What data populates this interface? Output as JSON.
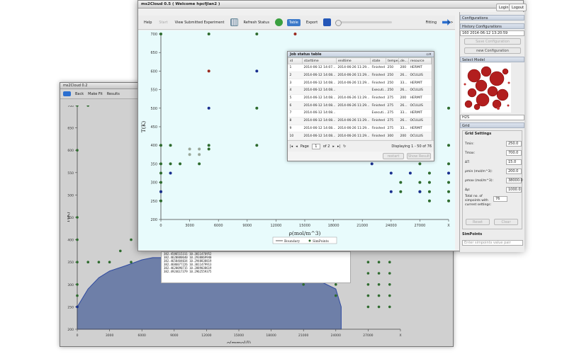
{
  "front": {
    "title": "ms2Cloud 0.5 ( Welcome hpcfjlan2 )",
    "login": "Login",
    "logout": "Logout",
    "toolbar": {
      "help": "Help",
      "start": "Start",
      "view_submitted": "View Submitted Experiment",
      "refresh": "Refresh Status",
      "table": "Table",
      "export": "Export",
      "fitting": "Fitting"
    },
    "chevrons": ">>"
  },
  "right_panel": {
    "configurations": "Configurations",
    "history_configurations": "History Configurations",
    "history_value": "160 2014-06-12 13:20:59",
    "save_configuration": "Save Configuration",
    "new_configuration": "new Configuration",
    "select_model": "Select Model",
    "model_value": "H2S",
    "grid": "Grid",
    "grid_settings": "Grid Settings",
    "fields": [
      {
        "label": "Tmin:",
        "value": "250.0"
      },
      {
        "label": "Tmax:",
        "value": "700.0"
      },
      {
        "label": "ΔT:",
        "value": "15.0"
      },
      {
        "label": "ρmin (mol/m^3):",
        "value": "200.0"
      },
      {
        "label": "ρmax (mol/m^3):",
        "value": "38000.0"
      },
      {
        "label": "Δρ:",
        "value": "1000.0"
      }
    ],
    "total_label": "Total no. of simpoints with current settings:",
    "total_value": "76",
    "reset": "Reset",
    "clear": "Clear",
    "simpoints": "SimPoints",
    "simpoints_placeholder": "Enter simpoints value pair"
  },
  "job_table": {
    "title": "Job status table",
    "columns": [
      "id",
      "starttime",
      "endtime",
      "state",
      "tempe...",
      "de...",
      "resource"
    ],
    "rows": [
      [
        "1",
        "2014-06-12 14:07...",
        "2014-06-26 11:29...",
        "Finished",
        "250",
        "200",
        "HERMIT"
      ],
      [
        "2",
        "2014-06-12 14:08...",
        "2014-06-26 11:29...",
        "Finished",
        "250",
        "26...",
        "OCULUS"
      ],
      [
        "3",
        "2014-06-12 14:08...",
        "2014-06-26 11:29...",
        "Finished",
        "250",
        "33...",
        "HERMIT"
      ],
      [
        "4",
        "2014-06-12 14:08...",
        "",
        "Executi...",
        "250",
        "26...",
        "OCULUS"
      ],
      [
        "5",
        "2014-06-12 14:08...",
        "2014-06-26 11:29...",
        "Finished",
        "275",
        "200",
        "HERMIT"
      ],
      [
        "6",
        "2014-06-12 14:08...",
        "2014-06-26 11:29...",
        "Finished",
        "275",
        "26...",
        "OCULUS"
      ],
      [
        "7",
        "2014-06-12 14:08...",
        "",
        "Executi...",
        "275",
        "33...",
        "HERMIT"
      ],
      [
        "8",
        "2014-06-12 14:08...",
        "2014-06-26 11:29...",
        "Finished",
        "275",
        "26...",
        "OCULUS"
      ],
      [
        "9",
        "2014-06-12 14:08...",
        "2014-06-26 11:29...",
        "Finished",
        "275",
        "33...",
        "HERMIT"
      ],
      [
        "10",
        "2014-06-12 14:08...",
        "2014-06-26 11:29...",
        "Finished",
        "300",
        "200",
        "OCULUS"
      ]
    ],
    "page_label": "Page",
    "page_value": "1",
    "of_pages": "of 2",
    "displaying": "Displaying 1 - 50 of 76",
    "restart": "restart",
    "show_result": "Show Result"
  },
  "back": {
    "title": "ms2Cloud 0.2",
    "back_btn": "Back",
    "make_fit": "Make Fit",
    "results": "Results"
  },
  "log_lines": [
    "382.4586515311   10.3011476952",
    "382.4620880640   10.2938869940",
    "382.4658484034   10.2948838819",
    "382.4686077226   10.3011479913",
    "382.4620090715   10.2889038619",
    "382.4924617379   10.2962559375"
  ],
  "colors": {
    "accent": "#3b79c9",
    "plot_bg_front": "#e8fbfc",
    "plot_bg_back": "#d6d6d6",
    "fill": "#6e7fa8",
    "green": "#2e6b2e",
    "blue": "#1a2f8f",
    "red": "#9a2a1f",
    "gray": "#9aa89a"
  },
  "chart_data": [
    {
      "type": "scatter",
      "xlabel": "ρ(mol/m^3)",
      "ylabel": "T(K)",
      "xticks": [
        "0",
        "3000",
        "6000",
        "9000",
        "12000",
        "15000",
        "18000",
        "21000",
        "24000",
        "27000",
        "X"
      ],
      "yticks": [
        "200",
        "250",
        "300",
        "350",
        "400",
        "450",
        "500",
        "550",
        "600",
        "650",
        "700"
      ],
      "xlim": [
        0,
        30000
      ],
      "ylim": [
        200,
        700
      ],
      "legend": [
        "Boundary",
        "SimPoints"
      ],
      "legend_position": "bottom",
      "points": {
        "green": [
          [
            0,
            250
          ],
          [
            0,
            275
          ],
          [
            0,
            300
          ],
          [
            0,
            325
          ],
          [
            0,
            350
          ],
          [
            0,
            400
          ],
          [
            0,
            700
          ],
          [
            1000,
            350
          ],
          [
            1000,
            400
          ],
          [
            2000,
            350
          ],
          [
            4000,
            350
          ],
          [
            5000,
            700
          ],
          [
            5000,
            400
          ],
          [
            5000,
            390
          ],
          [
            10000,
            700
          ],
          [
            10000,
            500
          ],
          [
            10000,
            400
          ],
          [
            25000,
            300
          ],
          [
            25000,
            275
          ],
          [
            27000,
            350
          ],
          [
            27000,
            300
          ],
          [
            27000,
            275
          ],
          [
            28000,
            325
          ],
          [
            28000,
            300
          ],
          [
            28000,
            275
          ],
          [
            28000,
            250
          ],
          [
            30000,
            500
          ],
          [
            30000,
            400
          ],
          [
            30000,
            350
          ],
          [
            30000,
            300
          ],
          [
            30000,
            275
          ],
          [
            30000,
            250
          ]
        ],
        "blue": [
          [
            0,
            275
          ],
          [
            1000,
            325
          ],
          [
            5000,
            500
          ],
          [
            10000,
            600
          ],
          [
            22000,
            350
          ],
          [
            24000,
            325
          ],
          [
            24000,
            275
          ],
          [
            26000,
            325
          ],
          [
            27000,
            275
          ],
          [
            30000,
            325
          ]
        ],
        "red": [
          [
            5000,
            600
          ],
          [
            14000,
            700
          ]
        ],
        "gray": [
          [
            3000,
            390
          ],
          [
            3000,
            375
          ],
          [
            4000,
            375
          ],
          [
            4000,
            390
          ]
        ]
      }
    },
    {
      "type": "scatter",
      "xlabel": "ρ(mmol/l)",
      "ylabel": "T(K)",
      "xticks": [
        "0",
        "3000",
        "6000",
        "9000",
        "12000",
        "15000",
        "18000",
        "21000",
        "24000",
        "27000",
        "X"
      ],
      "yticks": [
        "200",
        "250",
        "300",
        "350",
        "400",
        "450",
        "500",
        "550",
        "600",
        "650",
        "700"
      ],
      "xlim": [
        0,
        30000
      ],
      "ylim": [
        200,
        700
      ],
      "boundary": [
        [
          0,
          250
        ],
        [
          200,
          258
        ],
        [
          500,
          270
        ],
        [
          1000,
          290
        ],
        [
          2000,
          315
        ],
        [
          3000,
          330
        ],
        [
          4500,
          342
        ],
        [
          6000,
          355
        ],
        [
          7000,
          360
        ],
        [
          9000,
          360
        ],
        [
          12000,
          358
        ],
        [
          15000,
          355
        ],
        [
          18000,
          345
        ],
        [
          21000,
          325
        ],
        [
          24000,
          290
        ],
        [
          24500,
          250
        ]
      ],
      "points": {
        "green": [
          [
            0,
            700
          ],
          [
            0,
            600
          ],
          [
            0,
            450
          ],
          [
            0,
            400
          ],
          [
            0,
            350
          ],
          [
            0,
            300
          ],
          [
            0,
            275
          ],
          [
            0,
            250
          ],
          [
            1000,
            350
          ],
          [
            2000,
            350
          ],
          [
            3000,
            350
          ],
          [
            5000,
            350
          ],
          [
            4000,
            375
          ],
          [
            7000,
            380
          ],
          [
            6000,
            380
          ],
          [
            6000,
            395
          ],
          [
            5000,
            400
          ],
          [
            1000,
            700
          ],
          [
            12000,
            700
          ],
          [
            12000,
            650
          ],
          [
            12000,
            500
          ],
          [
            12000,
            400
          ],
          [
            27000,
            350
          ],
          [
            28000,
            350
          ],
          [
            29000,
            350
          ],
          [
            27000,
            325
          ],
          [
            28000,
            325
          ],
          [
            29000,
            325
          ],
          [
            27000,
            300
          ],
          [
            28000,
            300
          ],
          [
            29000,
            300
          ],
          [
            27000,
            275
          ],
          [
            28000,
            275
          ],
          [
            29000,
            275
          ],
          [
            27000,
            250
          ],
          [
            28000,
            250
          ],
          [
            29000,
            250
          ],
          [
            24000,
            300
          ],
          [
            24000,
            275
          ],
          [
            21000,
            300
          ]
        ],
        "blue": [
          [
            0,
            250
          ]
        ]
      }
    }
  ]
}
